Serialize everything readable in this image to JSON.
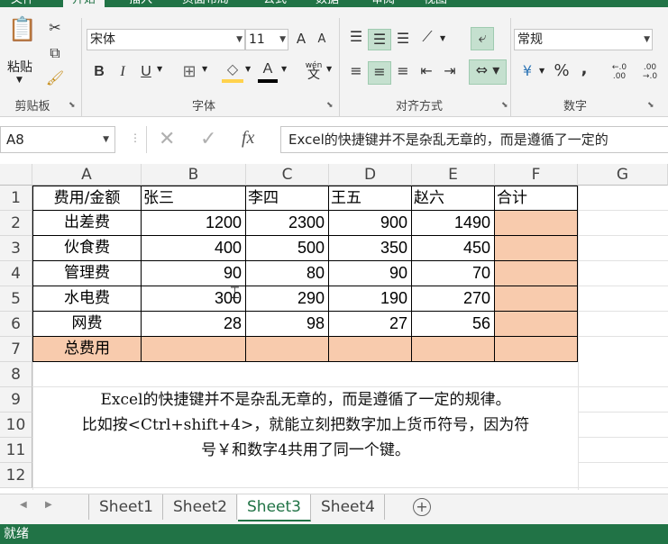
{
  "ribbon": {
    "tabs": [
      "文件",
      "开始",
      "插入",
      "页面布局",
      "公式",
      "数据",
      "审阅",
      "视图"
    ],
    "active_tab": "开始",
    "groups": {
      "clipboard": "剪贴板",
      "font": "字体",
      "alignment": "对齐方式",
      "number": "数字"
    },
    "paste_label": "粘贴",
    "font_name": "宋体",
    "font_size": "11",
    "number_format": "常规",
    "bold": "B",
    "italic": "I",
    "underline": "U",
    "grow_font": "A",
    "shrink_font": "A",
    "font_color_glyph": "A",
    "wen": "wén",
    "wen_char": "文",
    "percent": "%",
    "comma": ",",
    "currency_glyph": "¥",
    "dec_inc": "←.0 .00",
    "dec_dec": ".00 →.0"
  },
  "formula_bar": {
    "name_box": "A8",
    "fx": "fx",
    "content": "Excel的快捷键并不是杂乱无章的，而是遵循了一定的"
  },
  "columns": [
    "A",
    "B",
    "C",
    "D",
    "E",
    "F",
    "G"
  ],
  "rows": [
    "1",
    "2",
    "3",
    "4",
    "5",
    "6",
    "7",
    "8",
    "9",
    "10",
    "11",
    "12"
  ],
  "table": {
    "header": [
      "费用/金额",
      "张三",
      "李四",
      "王五",
      "赵六",
      "合计"
    ],
    "body": [
      [
        "出差费",
        "1200",
        "2300",
        "900",
        "1490",
        ""
      ],
      [
        "伙食费",
        "400",
        "500",
        "350",
        "450",
        ""
      ],
      [
        "管理费",
        "90",
        "80",
        "90",
        "70",
        ""
      ],
      [
        "水电费",
        "300",
        "290",
        "190",
        "270",
        ""
      ],
      [
        "网费",
        "28",
        "98",
        "27",
        "56",
        ""
      ],
      [
        "总费用",
        "",
        "",
        "",
        "",
        ""
      ]
    ]
  },
  "note": {
    "line1": "Excel的快捷键并不是杂乱无章的，而是遵循了一定的规律。",
    "line2": "比如按<Ctrl+shift+4>，就能立刻把数字加上货币符号，因为符",
    "line3": "号￥和数字4共用了同一个键。"
  },
  "sheets": [
    "Sheet1",
    "Sheet2",
    "Sheet3",
    "Sheet4"
  ],
  "active_sheet": "Sheet3",
  "status_text": "就绪",
  "colors": {
    "brand": "#217346",
    "highlight": "#f8cbad"
  }
}
